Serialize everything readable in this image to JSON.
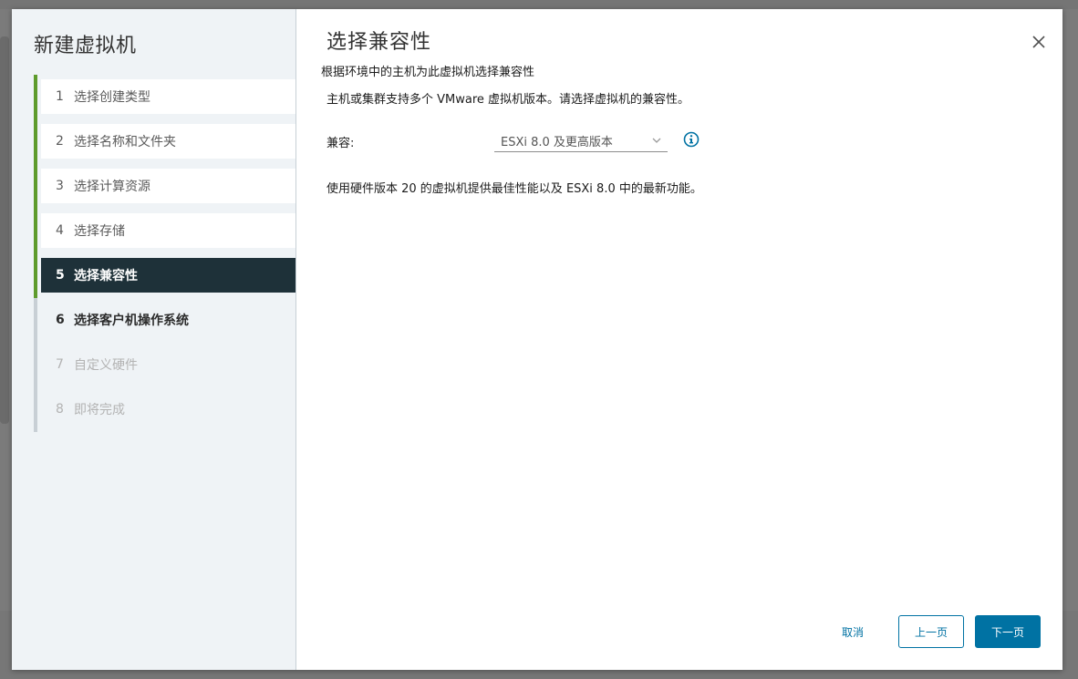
{
  "wizard": {
    "title": "新建虚拟机",
    "steps": [
      {
        "num": "1",
        "label": "选择创建类型",
        "state": "done"
      },
      {
        "num": "2",
        "label": "选择名称和文件夹",
        "state": "done"
      },
      {
        "num": "3",
        "label": "选择计算资源",
        "state": "done"
      },
      {
        "num": "4",
        "label": "选择存储",
        "state": "done"
      },
      {
        "num": "5",
        "label": "选择兼容性",
        "state": "current"
      },
      {
        "num": "6",
        "label": "选择客户机操作系统",
        "state": "next"
      },
      {
        "num": "7",
        "label": "自定义硬件",
        "state": "disabled"
      },
      {
        "num": "8",
        "label": "即将完成",
        "state": "disabled"
      }
    ]
  },
  "page": {
    "title": "选择兼容性",
    "subtitle": "根据环境中的主机为此虚拟机选择兼容性",
    "description": "主机或集群支持多个 VMware 虚拟机版本。请选择虚拟机的兼容性。",
    "compat_label": "兼容:",
    "compat_value": "ESXi 8.0 及更高版本",
    "hw_note": "使用硬件版本 20 的虚拟机提供最佳性能以及 ESXi 8.0 中的最新功能。"
  },
  "footer": {
    "cancel_label": "取消",
    "back_label": "上一页",
    "next_label": "下一页"
  },
  "colors": {
    "accent": "#0072a3",
    "progress_rail": "#5e9b2c",
    "current_step_bg": "#1e3139",
    "steps_pane_bg": "#eff3f6"
  }
}
